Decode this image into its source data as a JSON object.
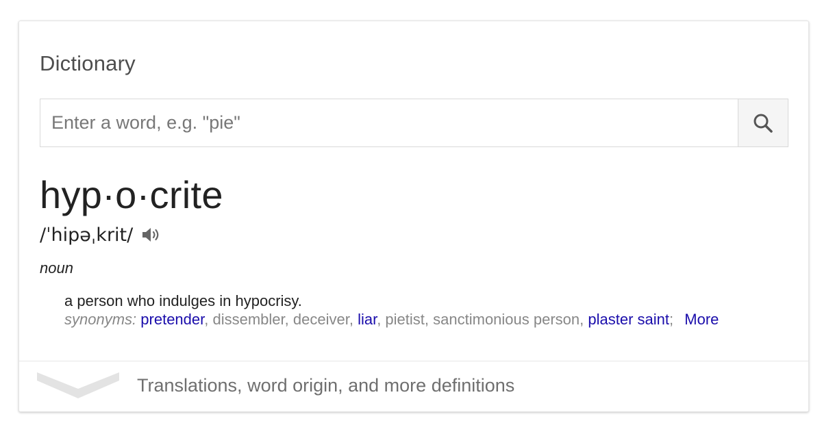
{
  "card": {
    "title": "Dictionary"
  },
  "search": {
    "placeholder": "Enter a word, e.g. \"pie\"",
    "value": "",
    "button_icon": "search-icon"
  },
  "entry": {
    "headword": "hyp·o·crite",
    "pronunciation": "/ˈhipəˌkrit/",
    "audio_icon": "speaker-icon",
    "part_of_speech": "noun",
    "definition": "a person who indulges in hypocrisy.",
    "synonyms_label": "synonyms:",
    "synonyms": [
      {
        "text": "pretender",
        "link": true
      },
      {
        "text": "dissembler",
        "link": false
      },
      {
        "text": "deceiver",
        "link": false
      },
      {
        "text": "liar",
        "link": true
      },
      {
        "text": "pietist",
        "link": false
      },
      {
        "text": "sanctimonious person",
        "link": false
      },
      {
        "text": "plaster saint",
        "link": true
      }
    ],
    "synonyms_end": ";",
    "more_label": "More"
  },
  "footer": {
    "expander_label": "Translations, word origin, and more definitions",
    "expander_icon": "chevron-down-icon"
  },
  "colors": {
    "link": "#1a0dab",
    "muted_text": "#878787",
    "primary_text": "#222222",
    "search_button_bg": "#f5f5f5"
  }
}
